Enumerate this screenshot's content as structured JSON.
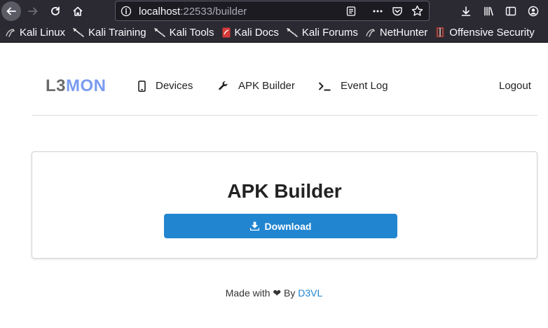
{
  "browser": {
    "url_host": "localhost",
    "url_rest": ":22533/builder",
    "bookmarks": [
      {
        "label": "Kali Linux",
        "icon": "kali-dragon-icon"
      },
      {
        "label": "Kali Training",
        "icon": "kali-sword-icon"
      },
      {
        "label": "Kali Tools",
        "icon": "kali-sword-icon"
      },
      {
        "label": "Kali Docs",
        "icon": "kali-docs-icon"
      },
      {
        "label": "Kali Forums",
        "icon": "kali-sword-icon"
      },
      {
        "label": "NetHunter",
        "icon": "kali-dragon-icon"
      },
      {
        "label": "Offensive Security",
        "icon": "offsec-icon"
      }
    ]
  },
  "nav": {
    "logo_part1": "L3",
    "logo_part2": "MON",
    "devices": "Devices",
    "apk_builder": "APK Builder",
    "event_log": "Event Log",
    "logout": "Logout"
  },
  "main": {
    "title": "APK Builder",
    "download_label": "Download"
  },
  "footer": {
    "made_with": "Made with ❤ By",
    "author": "D3VL"
  },
  "colors": {
    "accent": "#2185d0",
    "logo_mon": "#7b9bf0",
    "toolbar": "#2b2a33"
  }
}
